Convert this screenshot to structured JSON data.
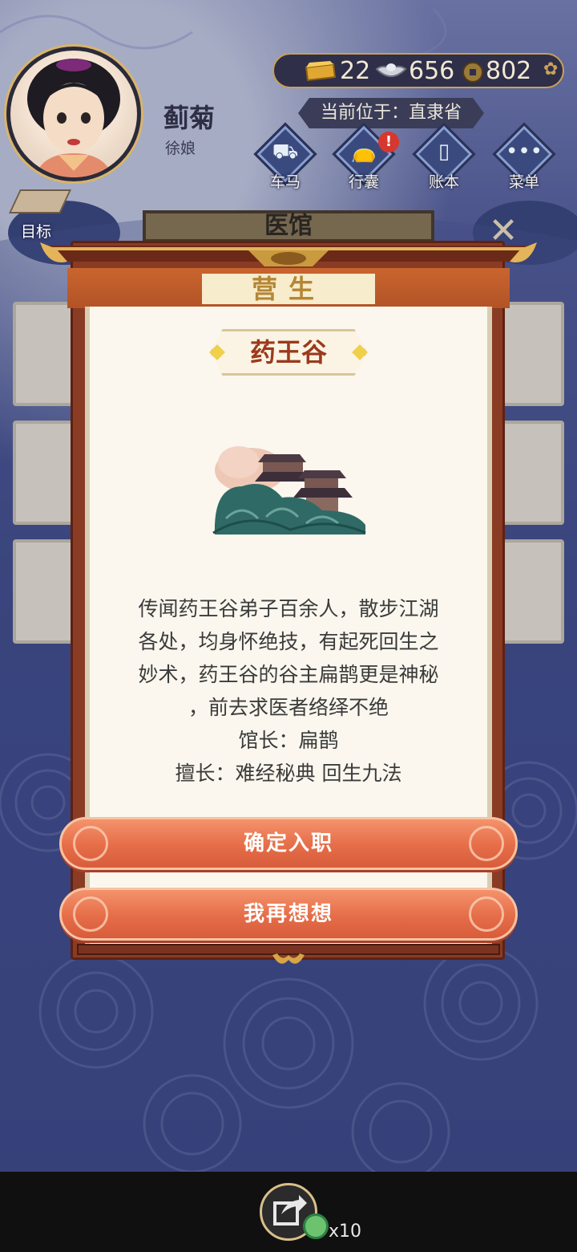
{
  "player": {
    "name": "蓟菊",
    "title": "徐娘"
  },
  "currency": {
    "gold": "22",
    "silver": "656",
    "copper": "802"
  },
  "location": "当前位于：直隶省",
  "nav": {
    "carriage": "车马",
    "luggage": "行囊",
    "ledger": "账本",
    "menu": "菜单",
    "luggage_badge": "!",
    "goal": "目标"
  },
  "background": {
    "title": "医馆"
  },
  "dialog": {
    "header": "营生",
    "place_name": "药王谷",
    "description_lines": [
      "传闻药王谷弟子百余人，散步江湖",
      "各处，均身怀绝技，有起死回生之",
      "妙术，药王谷的谷主扁鹊更是神秘",
      "，前去求医者络绎不绝",
      "馆长：扁鹊",
      "擅长：难经秘典 回生九法"
    ],
    "confirm_label": "确定入职",
    "cancel_label": "我再想想"
  },
  "footer": {
    "share_count": "x10"
  },
  "colors": {
    "accent_orange": "#e56d48",
    "frame_red": "#8a3b24",
    "paper": "#fbf7ee",
    "place_name": "#9b3a1c"
  }
}
